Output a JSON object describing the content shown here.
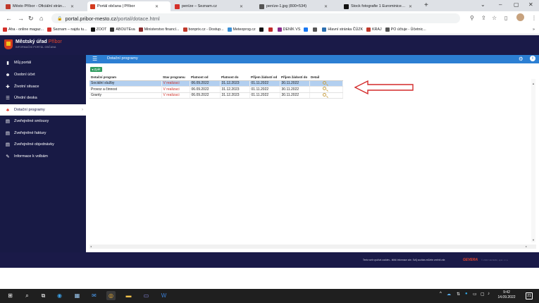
{
  "browser": {
    "tabs": [
      {
        "title": "Město Příbor - Oficiální stránky M",
        "color": "#c0392b"
      },
      {
        "title": "Portál občana | Příbor",
        "color": "#d33b1f"
      },
      {
        "title": "peníze – Seznam.cz",
        "color": "#d4302a"
      },
      {
        "title": "peníze-1.jpg (800×534)",
        "color": "#555555"
      },
      {
        "title": "Stock fotografie 1 Eurominice Let",
        "color": "#111111"
      }
    ],
    "new_tab": "+",
    "window_controls": [
      "⌄",
      "–",
      "▢",
      "✕"
    ],
    "url_host": "portal.pribor-mesto.cz",
    "url_path": "/portal/dotace.html",
    "bookmarks": [
      {
        "label": "Aha - online magaz...",
        "color": "#d4302a"
      },
      {
        "label": "Seznam – najdu tu...",
        "color": "#d4302a"
      },
      {
        "label": "ZOOT",
        "color": "#111111"
      },
      {
        "label": "ABOUTEva",
        "color": "#333333"
      },
      {
        "label": "Ministerstvo financí...",
        "color": "#8a2a2a"
      },
      {
        "label": "bonprix.cz - Dostup...",
        "color": "#c0392b"
      },
      {
        "label": "Meteoprog.cz",
        "color": "#3a8fd4"
      },
      {
        "label": "",
        "color": "#111111"
      },
      {
        "label": "",
        "color": "#c02a2a"
      },
      {
        "label": "DENÍK VS",
        "color": "#8a2a8a"
      },
      {
        "label": "",
        "color": "#1877f2"
      },
      {
        "label": "",
        "color": "#555555"
      },
      {
        "label": "Hlavní stránka ČÚZK",
        "color": "#2c6fb0"
      },
      {
        "label": "KRAJ",
        "color": "#c0392b"
      },
      {
        "label": "PO účtuje - Účetnic...",
        "color": "#555555"
      }
    ],
    "bookmarks_more": "»"
  },
  "portal": {
    "brand_name": "Městský úřad",
    "brand_place": "Příbor",
    "brand_sub": "INFORMAČNÍ PORTÁL OBČANA",
    "page_title": "Dotační programy",
    "back_label": "Zpět",
    "sidebar": [
      {
        "label": "Můj portál",
        "icon": "▮"
      },
      {
        "label": "Osobní účet",
        "icon": "☻"
      },
      {
        "label": "Životní situace",
        "icon": "✚"
      },
      {
        "label": "Úřední deska",
        "icon": "☰"
      },
      {
        "label": "Dotační programy",
        "icon": "♣"
      },
      {
        "label": "Zveřejněné smlouvy",
        "icon": "▤"
      },
      {
        "label": "Zveřejněné faktury",
        "icon": "▤"
      },
      {
        "label": "Zveřejněné objednávky",
        "icon": "▤"
      },
      {
        "label": "Informace k volbám",
        "icon": "✎"
      }
    ],
    "active_index": 4,
    "table": {
      "columns": [
        "Dotační program",
        "Stav programu",
        "Platnost od",
        "Platnost do",
        "Příjem žádostí od",
        "Příjem žádostí do",
        "Detail"
      ],
      "rows": [
        [
          "Sociální služby",
          "V realizaci",
          "06.09.2022",
          "31.12.2023",
          "01.11.2022",
          "30.11.2022"
        ],
        [
          "Provoz a činnost",
          "V realizaci",
          "06.09.2022",
          "31.12.2023",
          "01.11.2022",
          "30.11.2022"
        ],
        [
          "Granty",
          "V realizaci",
          "06.09.2022",
          "31.12.2023",
          "01.11.2022",
          "30.11.2022"
        ]
      ],
      "selected_row": 0
    },
    "footer_text": "Tento web využívá cookies - bližší informace zde. Svůj souhlas můžete změnit zde.",
    "footer_brand": "GEVERA",
    "footer_copy": "© 2022 GEVERA, spol. s r.o."
  },
  "taskbar": {
    "time": "9:42",
    "date": "14.09.2022",
    "notifications": "21"
  },
  "colors": {
    "header_navy": "#1a1a48",
    "accent_blue": "#2c7fd3",
    "status_red": "#d0322a",
    "selected_row": "#b2cff0"
  }
}
